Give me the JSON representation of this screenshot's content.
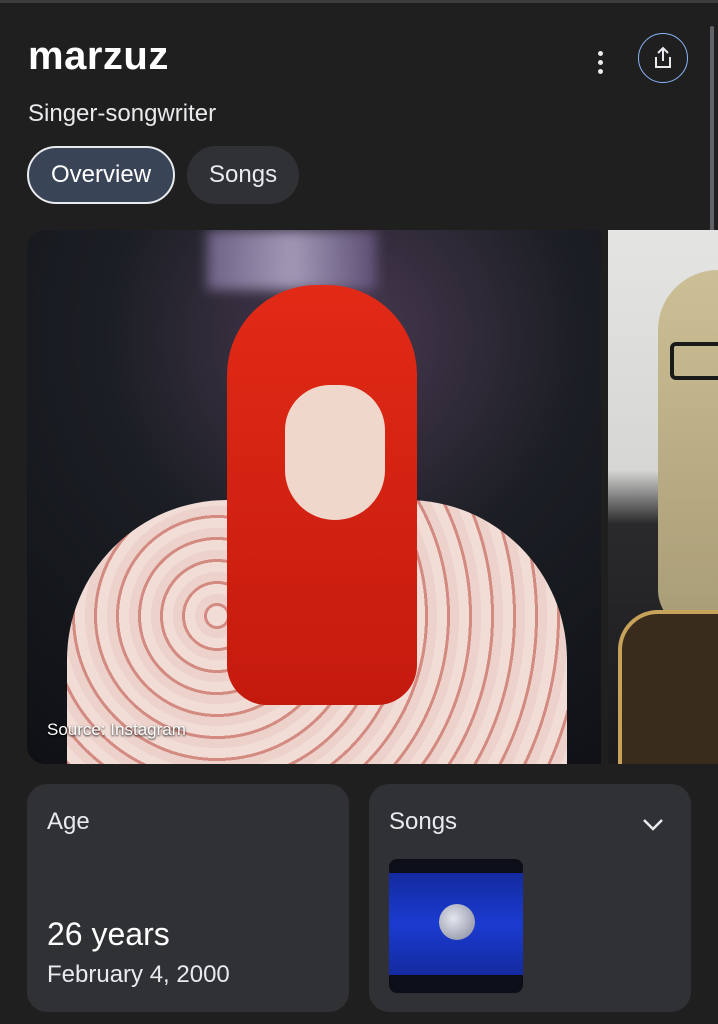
{
  "entity": {
    "name": "marzuz",
    "description": "Singer-songwriter"
  },
  "actions": {
    "more_icon": "more-vert-icon",
    "share_icon": "share-icon"
  },
  "tabs": [
    {
      "label": "Overview",
      "active": true
    },
    {
      "label": "Songs",
      "active": false
    }
  ],
  "images": {
    "source_label": "Source: Instagram"
  },
  "cards": {
    "age": {
      "label": "Age",
      "value": "26 years",
      "birth_date": "February 4, 2000"
    },
    "songs": {
      "label": "Songs",
      "expand_icon": "chevron-down-icon"
    }
  },
  "colors": {
    "background": "#1f1f1f",
    "card": "#303134",
    "active_tab": "#394457",
    "accent": "#8ab4f8"
  }
}
